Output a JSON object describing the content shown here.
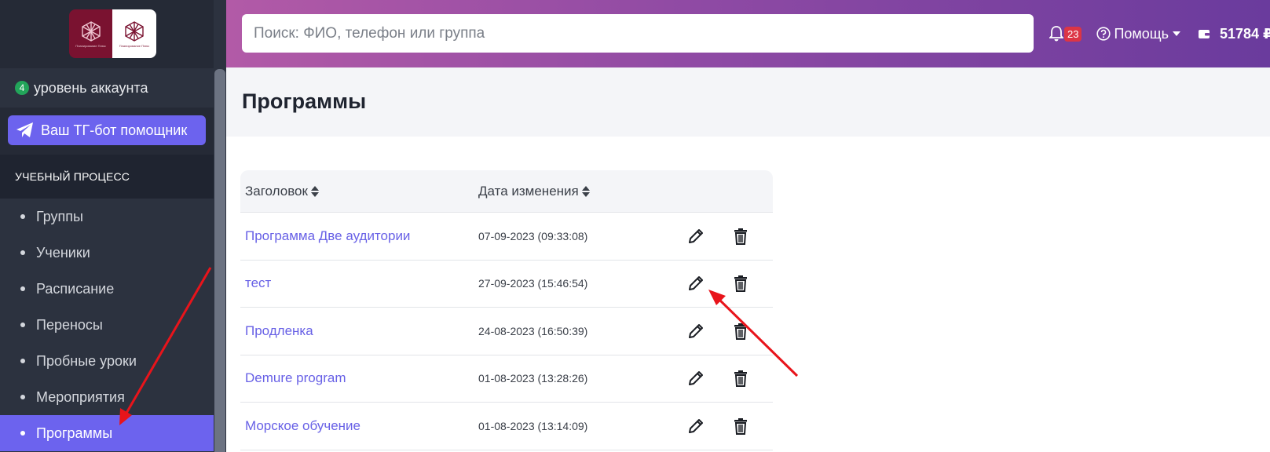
{
  "sidebar": {
    "account_level_badge": "4",
    "account_level_text": "уровень аккаунта",
    "tg_bot_label": "Ваш ТГ-бот помощник",
    "section_title": "УЧЕБНЫЙ ПРОЦЕСС",
    "items": [
      {
        "label": "Группы"
      },
      {
        "label": "Ученики"
      },
      {
        "label": "Расписание"
      },
      {
        "label": "Переносы"
      },
      {
        "label": "Пробные уроки"
      },
      {
        "label": "Мероприятия"
      },
      {
        "label": "Программы"
      }
    ],
    "active_item": "Программы"
  },
  "topbar": {
    "search_placeholder": "Поиск: ФИО, телефон или группа",
    "notifications_count": "23",
    "help_label": "Помощь",
    "balance": "51784 ₽"
  },
  "page": {
    "title": "Программы"
  },
  "table": {
    "columns": [
      "Заголовок",
      "Дата изменения"
    ],
    "rows": [
      {
        "title": "Программа Две аудитории",
        "date": "07-09-2023 (09:33:08)"
      },
      {
        "title": "тест",
        "date": "27-09-2023 (15:46:54)"
      },
      {
        "title": "Продленка",
        "date": "24-08-2023 (16:50:39)"
      },
      {
        "title": "Demure program",
        "date": "01-08-2023 (13:28:26)"
      },
      {
        "title": "Морское обучение",
        "date": "01-08-2023 (13:14:09)"
      }
    ]
  },
  "colors": {
    "accent": "#6c63ee",
    "annotation_arrow": "#e8141b",
    "sidebar_bg": "#2c323f"
  },
  "icons": [
    "telegram-icon",
    "bell-icon",
    "help-circle-icon",
    "wallet-icon",
    "sort-icon",
    "pencil-icon",
    "trash-icon"
  ]
}
